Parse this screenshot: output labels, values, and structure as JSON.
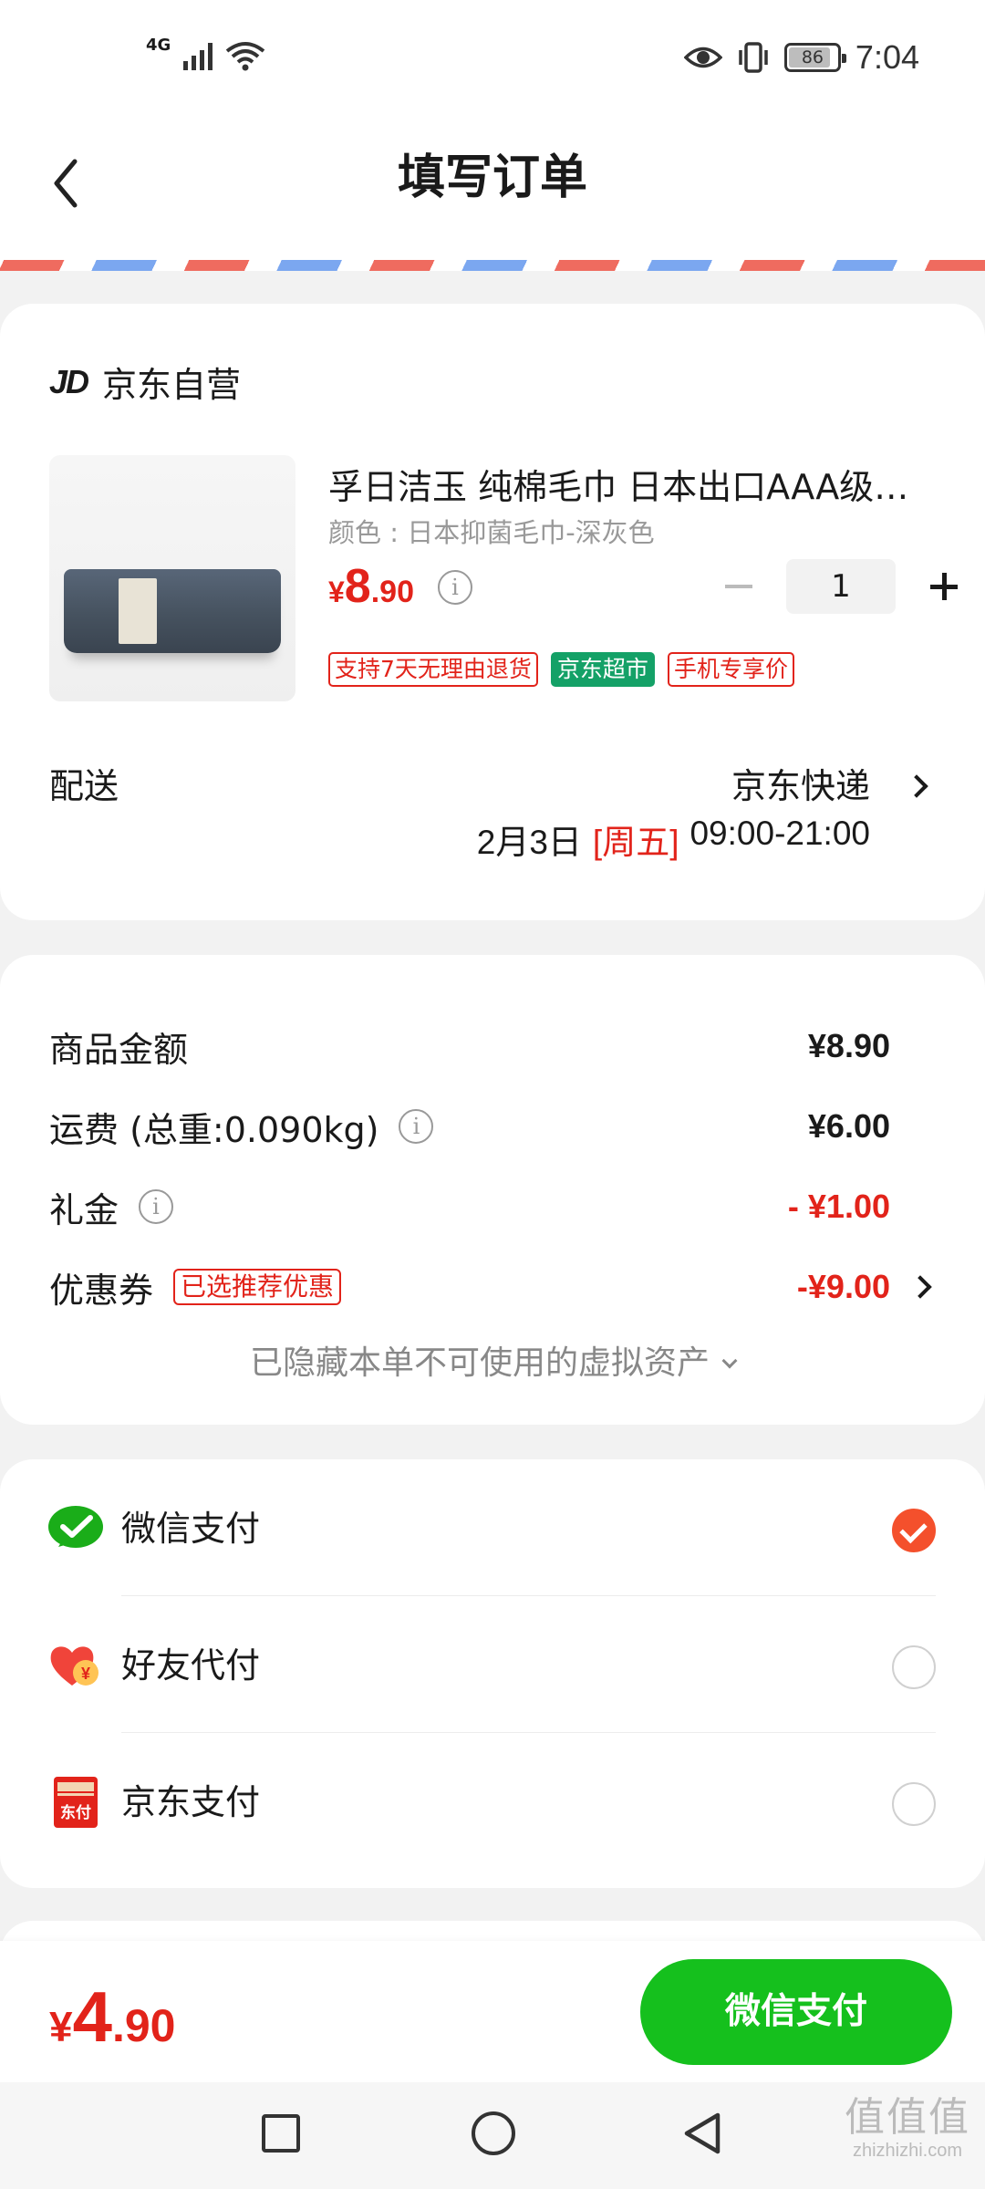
{
  "status_bar": {
    "network_label": "4G",
    "battery_level": "86",
    "battery_fraction": 0.86,
    "time": "7:04",
    "icons": [
      "signal-icon",
      "wifi-icon",
      "eye-icon",
      "vibrate-icon",
      "battery-icon"
    ]
  },
  "header": {
    "title": "填写订单",
    "back_icon": "chevron-left-icon"
  },
  "store": {
    "logo": "JD",
    "name": "京东自营"
  },
  "product": {
    "title": "孚日洁玉 纯棉毛巾 日本出口AAA级…",
    "spec": "颜色 : 日本抑菌毛巾-深灰色",
    "price_symbol": "¥",
    "price_int": "8",
    "price_dec": ".90",
    "quantity": "1",
    "tags": [
      "支持7天无理由退货",
      "京东超市",
      "手机专享价"
    ]
  },
  "delivery": {
    "label": "配送",
    "carrier": "京东快递",
    "date": "2月3日",
    "weekday": "[周五]",
    "time_range": "09:00-21:00"
  },
  "summary": {
    "goods_label": "商品金额",
    "goods_value": "¥8.90",
    "shipping_label": "运费 (总重:0.090kg)",
    "shipping_value": "¥6.00",
    "gift_label": "礼金",
    "gift_value": "- ¥1.00",
    "coupon_label": "优惠券",
    "coupon_badge": "已选推荐优惠",
    "coupon_value": "-¥9.00",
    "hidden_assets": "已隐藏本单不可使用的虚拟资产"
  },
  "payment": {
    "methods": [
      {
        "label": "微信支付",
        "icon": "wechat-pay-icon",
        "selected": true
      },
      {
        "label": "好友代付",
        "icon": "friend-pay-icon",
        "selected": false
      },
      {
        "label": "京东支付",
        "icon": "jd-pay-icon",
        "selected": false
      }
    ],
    "jd_pay_icon_text": "东付",
    "friend_pay_icon_text": "¥"
  },
  "footer": {
    "total_symbol": "¥",
    "total_int": "4",
    "total_dec": ".90",
    "pay_button": "微信支付"
  },
  "watermark": {
    "top": "值值值",
    "bottom": "zhizhizhi.com"
  },
  "colors": {
    "accent_red": "#e2231a",
    "pay_green": "#15c01d",
    "radio_orange": "#f4502c",
    "tag_green": "#14a167"
  }
}
